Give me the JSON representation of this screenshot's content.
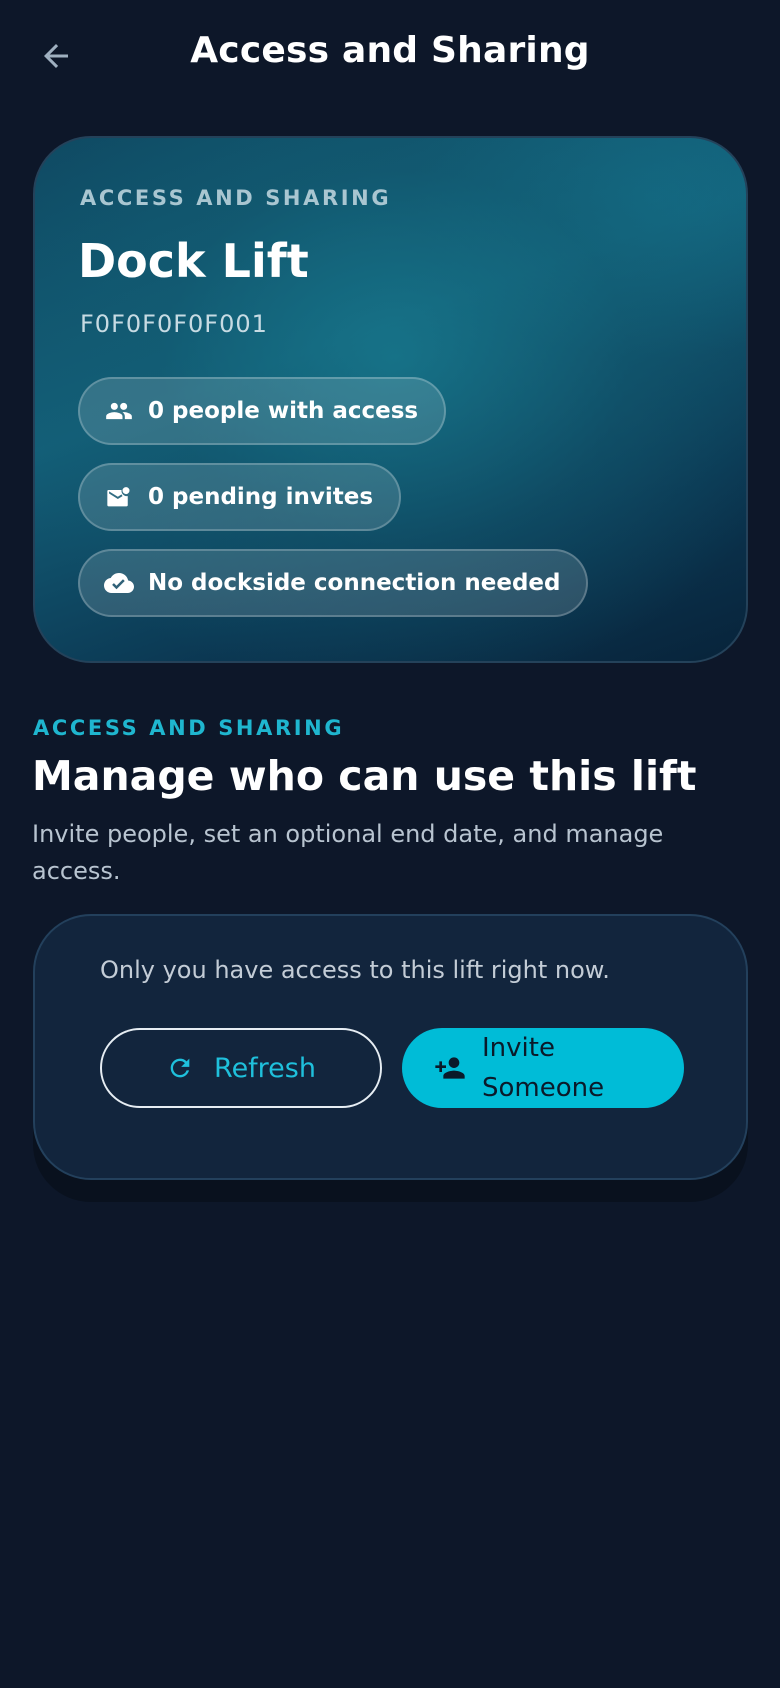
{
  "header": {
    "title": "Access and Sharing",
    "back_icon": "arrow-left-icon"
  },
  "hero": {
    "eyebrow": "ACCESS AND SHARING",
    "device_name": "Dock Lift",
    "serial": "F0F0F0F0F001",
    "chips": [
      {
        "icon": "people-icon",
        "label": "0 people with access"
      },
      {
        "icon": "mail-icon",
        "label": "0 pending invites"
      },
      {
        "icon": "cloud-done-icon",
        "label": "No dockside connection needed"
      }
    ]
  },
  "section": {
    "eyebrow": "ACCESS AND SHARING",
    "title": "Manage who can use this lift",
    "description": "Invite people, set an optional end date, and manage access."
  },
  "access_card": {
    "message": "Only you have access to this lift right now.",
    "refresh_label": "Refresh",
    "invite_label": "Invite Someone"
  },
  "colors": {
    "background": "#0d1729",
    "accent": "#00bcd7",
    "card": "#12253d"
  }
}
